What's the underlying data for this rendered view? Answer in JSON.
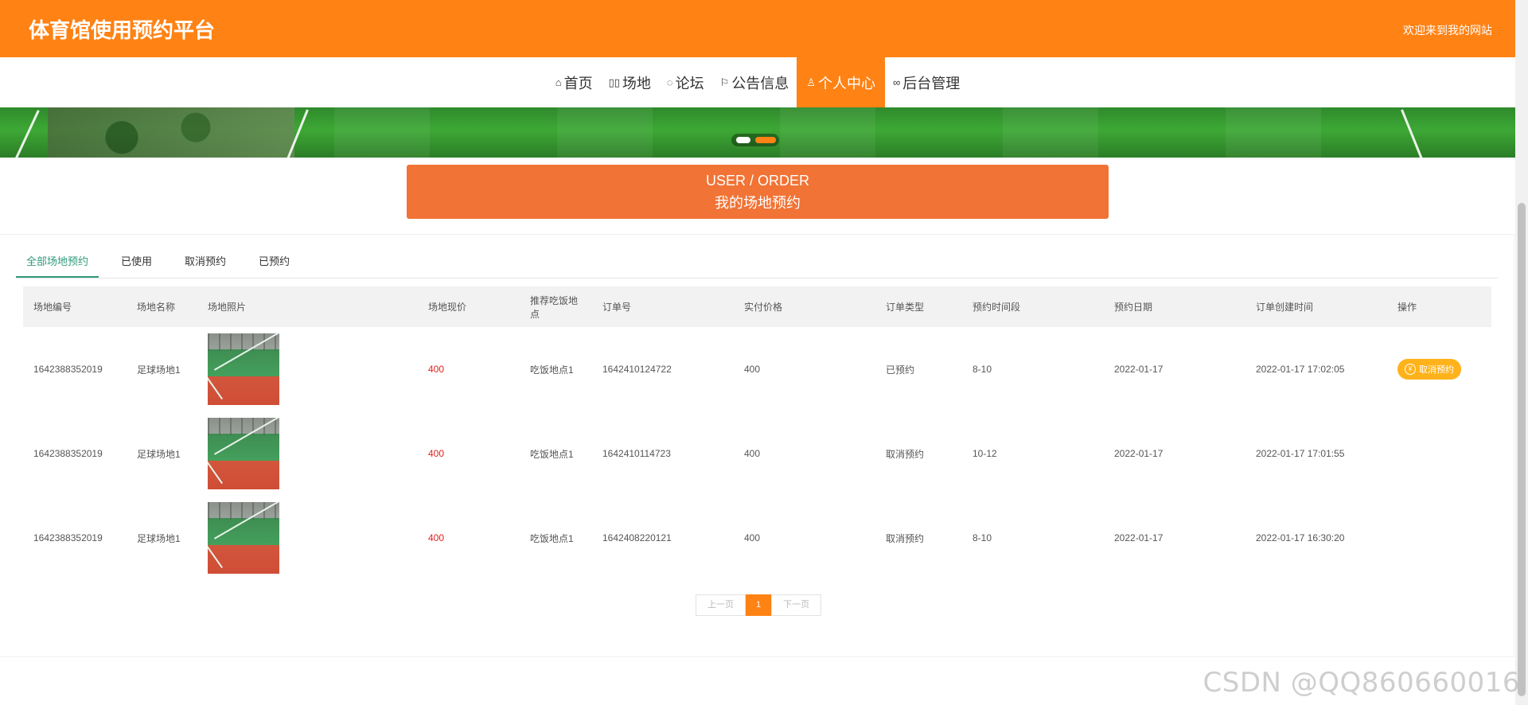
{
  "header": {
    "site_title": "体育馆使用预约平台",
    "welcome": "欢迎来到我的网站",
    "background": "#ff8214"
  },
  "nav": {
    "items": [
      {
        "label": "首页",
        "icon": "home-icon"
      },
      {
        "label": "场地",
        "icon": "grid-icon"
      },
      {
        "label": "论坛",
        "icon": "compass-icon"
      },
      {
        "label": "公告信息",
        "icon": "flag-icon"
      },
      {
        "label": "个人中心",
        "icon": "user-icon",
        "active": true
      },
      {
        "label": "后台管理",
        "icon": "link-icon"
      }
    ]
  },
  "title_box": {
    "en": "USER / ORDER",
    "zh": "我的场地预约"
  },
  "tabs": [
    "全部场地预约",
    "已使用",
    "取消预约",
    "已预约"
  ],
  "table": {
    "headers": [
      "场地编号",
      "场地名称",
      "场地照片",
      "场地现价",
      "推荐吃饭地点",
      "订单号",
      "实付价格",
      "订单类型",
      "预约时间段",
      "预约日期",
      "订单创建时间",
      "操作"
    ],
    "rows": [
      {
        "code": "1642388352019",
        "name": "足球场地1",
        "price": "400",
        "food": "吃饭地点1",
        "order_no": "1642410124722",
        "paid": "400",
        "type": "已预约",
        "slot": "8-10",
        "date": "2022-01-17",
        "created": "2022-01-17 17:02:05",
        "action": "取消预约"
      },
      {
        "code": "1642388352019",
        "name": "足球场地1",
        "price": "400",
        "food": "吃饭地点1",
        "order_no": "1642410114723",
        "paid": "400",
        "type": "取消预约",
        "slot": "10-12",
        "date": "2022-01-17",
        "created": "2022-01-17 17:01:55",
        "action": ""
      },
      {
        "code": "1642388352019",
        "name": "足球场地1",
        "price": "400",
        "food": "吃饭地点1",
        "order_no": "1642408220121",
        "paid": "400",
        "type": "取消预约",
        "slot": "8-10",
        "date": "2022-01-17",
        "created": "2022-01-17 16:30:20",
        "action": ""
      }
    ]
  },
  "pager": {
    "prev": "上一页",
    "current": "1",
    "next": "下一页"
  },
  "watermark": "CSDN @QQ860660016",
  "colors": {
    "accent": "#ff8214",
    "title_box": "#f17335",
    "price": "#e0201c",
    "tab_active": "#2f9a7a",
    "cancel_button": "#ffb21a"
  }
}
